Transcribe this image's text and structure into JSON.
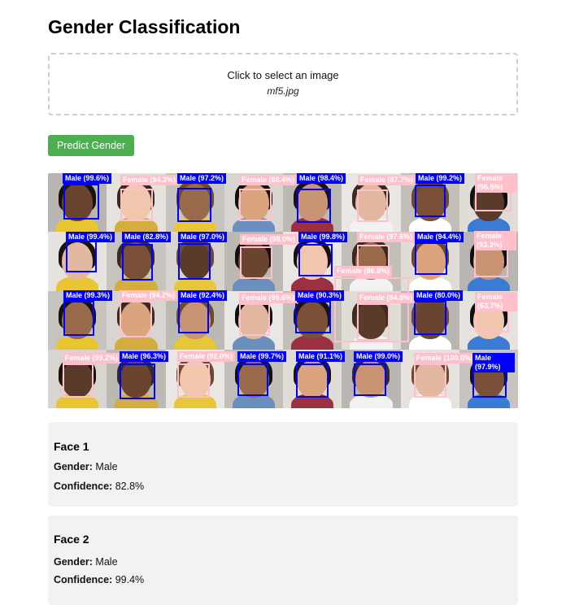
{
  "page": {
    "title": "Gender Classification",
    "upload_prompt": "Click to select an image",
    "upload_filename": "mf5.jpg",
    "predict_button": "Predict Gender"
  },
  "colors": {
    "male_box": "#0000ff",
    "female_box": "#ffc0cb",
    "button": "#4caf50",
    "card_bg": "#f2f2f2"
  },
  "detections": [
    {
      "label": "Male (99.6%)",
      "gender": "male"
    },
    {
      "label": "Female (94.3%)",
      "gender": "female"
    },
    {
      "label": "Male (97.2%)",
      "gender": "male"
    },
    {
      "label": "Female (88.4%)",
      "gender": "female"
    },
    {
      "label": "Male (98.4%)",
      "gender": "male"
    },
    {
      "label": "Female (87.7%)",
      "gender": "female"
    },
    {
      "label": "Male (99.2%)",
      "gender": "male"
    },
    {
      "label": "Female (96.5%)",
      "gender": "female"
    },
    {
      "label": "Male (99.4%)",
      "gender": "male"
    },
    {
      "label": "Male (82.8%)",
      "gender": "male"
    },
    {
      "label": "Male (97.0%)",
      "gender": "male"
    },
    {
      "label": "Female (98.0%)",
      "gender": "female"
    },
    {
      "label": "Male (99.8%)",
      "gender": "male"
    },
    {
      "label": "Female (97.6%)",
      "gender": "female"
    },
    {
      "label": "Male (94.4%)",
      "gender": "male"
    },
    {
      "label": "Female (93.3%)",
      "gender": "female"
    },
    {
      "label": "Female (86.8%)",
      "gender": "female"
    },
    {
      "label": "Male (99.3%)",
      "gender": "male"
    },
    {
      "label": "Female (94.2%)",
      "gender": "female"
    },
    {
      "label": "Male (92.4%)",
      "gender": "male"
    },
    {
      "label": "Female (99.6%)",
      "gender": "female"
    },
    {
      "label": "Male (90.3%)",
      "gender": "male"
    },
    {
      "label": "Female (84.8%)",
      "gender": "female"
    },
    {
      "label": "Male (80.0%)",
      "gender": "male"
    },
    {
      "label": "Female (63.7%)",
      "gender": "female"
    },
    {
      "label": "Female (99.2%)",
      "gender": "female"
    },
    {
      "label": "Male (96.3%)",
      "gender": "male"
    },
    {
      "label": "Female (92.0%)",
      "gender": "female"
    },
    {
      "label": "Male (99.7%)",
      "gender": "male"
    },
    {
      "label": "Male (91.1%)",
      "gender": "male"
    },
    {
      "label": "Male (99.0%)",
      "gender": "male"
    },
    {
      "label": "Female (100.0%)",
      "gender": "female"
    },
    {
      "label": "Male (97.9%)",
      "gender": "male"
    }
  ],
  "results": [
    {
      "title": "Face 1",
      "gender_label": "Gender:",
      "gender": "Male",
      "confidence_label": "Confidence:",
      "confidence": "82.8%"
    },
    {
      "title": "Face 2",
      "gender_label": "Gender:",
      "gender": "Male",
      "confidence_label": "Confidence:",
      "confidence": "99.4%"
    }
  ]
}
